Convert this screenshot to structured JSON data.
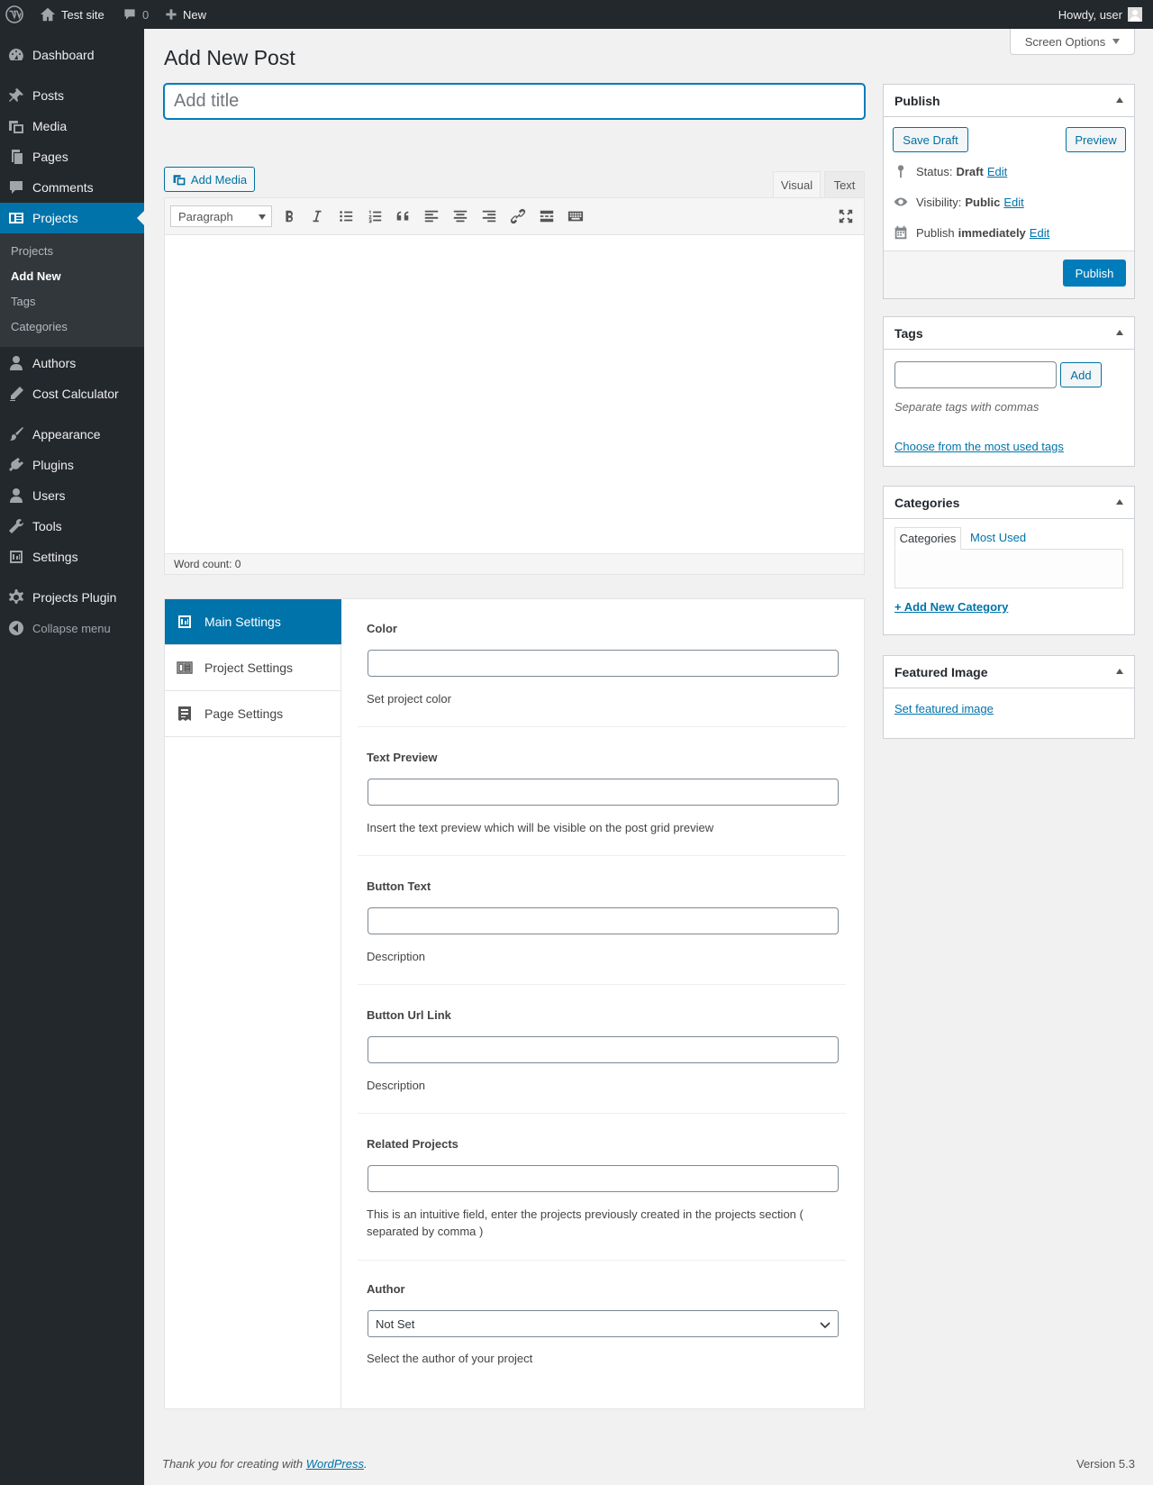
{
  "adminbar": {
    "site_name": "Test site",
    "comments_count": "0",
    "new_label": "New",
    "greeting": "Howdy, user"
  },
  "sidebar": {
    "items": [
      {
        "label": "Dashboard",
        "icon": "dashboard-icon"
      },
      {
        "label": "Posts",
        "icon": "pin-icon"
      },
      {
        "label": "Media",
        "icon": "media-icon"
      },
      {
        "label": "Pages",
        "icon": "pages-icon"
      },
      {
        "label": "Comments",
        "icon": "comment-icon"
      },
      {
        "label": "Projects",
        "icon": "projects-icon"
      },
      {
        "label": "Authors",
        "icon": "user-icon"
      },
      {
        "label": "Cost Calculator",
        "icon": "pencil-icon"
      },
      {
        "label": "Appearance",
        "icon": "brush-icon"
      },
      {
        "label": "Plugins",
        "icon": "plugin-icon"
      },
      {
        "label": "Users",
        "icon": "user-icon"
      },
      {
        "label": "Tools",
        "icon": "wrench-icon"
      },
      {
        "label": "Settings",
        "icon": "settings-icon"
      },
      {
        "label": "Projects Plugin",
        "icon": "gear-icon"
      },
      {
        "label": "Collapse menu",
        "icon": "collapse-icon"
      }
    ],
    "submenu": [
      "Projects",
      "Add New",
      "Tags",
      "Categories"
    ]
  },
  "page": {
    "title": "Add New Post",
    "screen_options": "Screen Options",
    "title_placeholder": "Add title"
  },
  "editor": {
    "add_media": "Add Media",
    "tab_visual": "Visual",
    "tab_text": "Text",
    "format": "Paragraph",
    "word_count": "Word count: 0"
  },
  "settings": {
    "tabs": [
      "Main Settings",
      "Project Settings",
      "Page Settings"
    ],
    "fields": [
      {
        "label": "Color",
        "desc": "Set project color"
      },
      {
        "label": "Text Preview",
        "desc": "Insert the text preview which will be visible on the post grid preview"
      },
      {
        "label": "Button Text",
        "desc": "Description"
      },
      {
        "label": "Button Url Link",
        "desc": "Description"
      },
      {
        "label": "Related Projects",
        "desc": "This is an intuitive field, enter the projects previously created in the projects section ( separated by comma )"
      },
      {
        "label": "Author",
        "desc": "Select the author of your project",
        "value": "Not Set"
      }
    ]
  },
  "publish": {
    "title": "Publish",
    "save_draft": "Save Draft",
    "preview": "Preview",
    "status_label": "Status:",
    "status_value": "Draft",
    "visibility_label": "Visibility:",
    "visibility_value": "Public",
    "publish_label": "Publish",
    "publish_value": "immediately",
    "edit": "Edit",
    "publish_button": "Publish"
  },
  "tags": {
    "title": "Tags",
    "add": "Add",
    "hint": "Separate tags with commas",
    "choose": "Choose from the most used tags"
  },
  "categories": {
    "title": "Categories",
    "tab_all": "Categories",
    "tab_used": "Most Used",
    "add_new": "+ Add New Category"
  },
  "featured": {
    "title": "Featured Image",
    "set": "Set featured image"
  },
  "footer": {
    "text_prefix": "Thank you for creating with ",
    "link": "WordPress",
    "text_suffix": ".",
    "version": "Version 5.3"
  },
  "colors": {
    "accent": "#0073aa",
    "sidebar": "#23282d",
    "submenu": "#32373c"
  }
}
